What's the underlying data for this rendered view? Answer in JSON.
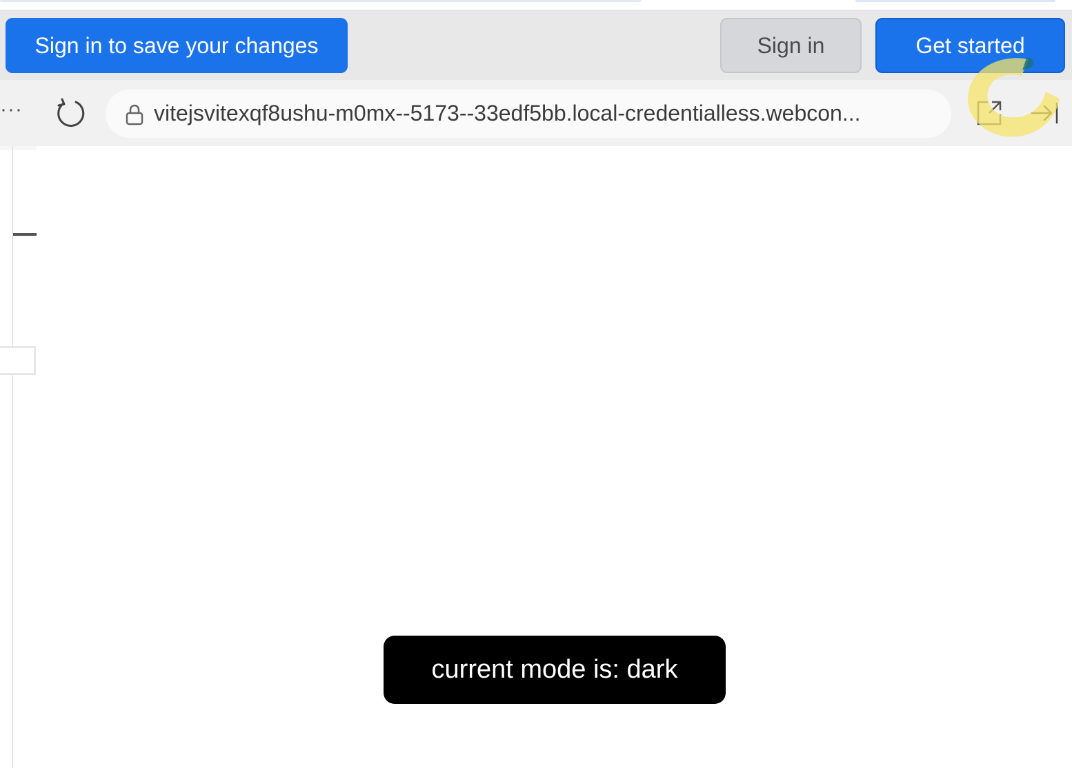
{
  "banner": {
    "save_prompt": "Sign in to save your changes",
    "sign_in": "Sign in",
    "get_started": "Get started"
  },
  "toolbar": {
    "more": "···",
    "url": "vitejsvitexqf8ushu-m0mx--5173--33edf5bb.local-credentialless.webcon..."
  },
  "preview": {
    "toast_text": "current mode is: dark"
  },
  "icons": {
    "reload": "reload-icon",
    "lock": "lock-icon",
    "open_external": "open-in-new-window-icon",
    "collapse": "collapse-panel-icon"
  },
  "colors": {
    "primary": "#1a73ea",
    "banner_bg": "#e8e8e8",
    "toolbar_bg": "#f1f1f1",
    "toast_bg": "#000000",
    "highlight": "#f5e36a"
  }
}
